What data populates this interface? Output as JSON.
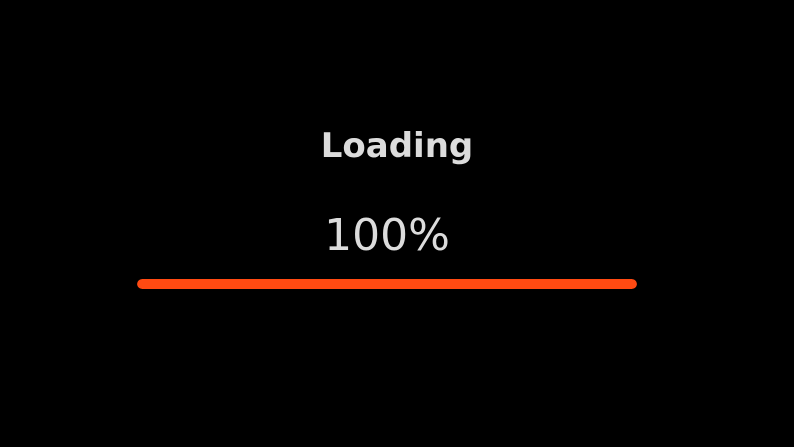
{
  "loader": {
    "title": "Loading",
    "percent_label": "100%",
    "progress_fraction": 1.0,
    "bar_color": "#ff4a12",
    "text_color": "#dcdcdc",
    "background_color": "#000000"
  }
}
